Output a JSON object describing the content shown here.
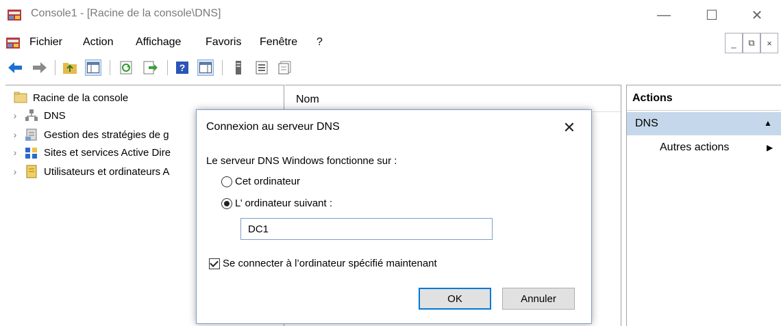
{
  "window": {
    "title": "Console1 - [Racine de la console\\DNS]",
    "minimize": "—",
    "maximize": "☐",
    "close": "✕"
  },
  "menu": {
    "items": [
      "Fichier",
      "Action",
      "Affichage",
      "Favoris",
      "Fenêtre",
      "?"
    ],
    "mdi": {
      "minimize": "_",
      "restore": "⧉",
      "close": "×"
    }
  },
  "toolbar": {
    "icons": [
      "back-arrow-icon",
      "forward-arrow-icon",
      "up-folder-icon",
      "show-hide-tree-icon",
      "refresh-icon",
      "export-list-icon",
      "help-icon",
      "show-hide-action-pane-icon",
      "server-icon",
      "list-view-icon",
      "properties-icon"
    ]
  },
  "tree": {
    "root": "Racine de la console",
    "items": [
      {
        "label": "DNS",
        "icon": "dns-server-icon"
      },
      {
        "label": "Gestion des stratégies de g",
        "icon": "group-policy-icon"
      },
      {
        "label": "Sites et services Active Dire",
        "icon": "sites-services-icon"
      },
      {
        "label": "Utilisateurs et ordinateurs A",
        "icon": "ad-users-icon"
      }
    ]
  },
  "center": {
    "column_header": "Nom"
  },
  "actions": {
    "title": "Actions",
    "section": "DNS",
    "more_actions": "Autres actions"
  },
  "dialog": {
    "title": "Connexion au serveur DNS",
    "close": "✕",
    "prompt": "Le serveur DNS Windows fonctionne sur :",
    "radio_this": "Cet ordinateur",
    "radio_other": "L’ ordinateur suivant :",
    "radio_selected": "other",
    "server_value": "DC1",
    "checkbox_label": "Se connecter à l’ordinateur spécifié maintenant",
    "checkbox_checked": true,
    "ok_label": "OK",
    "cancel_label": "Annuler"
  },
  "colors": {
    "selection": "#c5d7ea",
    "dialog_border": "#7a9ec9",
    "default_button": "#0078d7"
  }
}
